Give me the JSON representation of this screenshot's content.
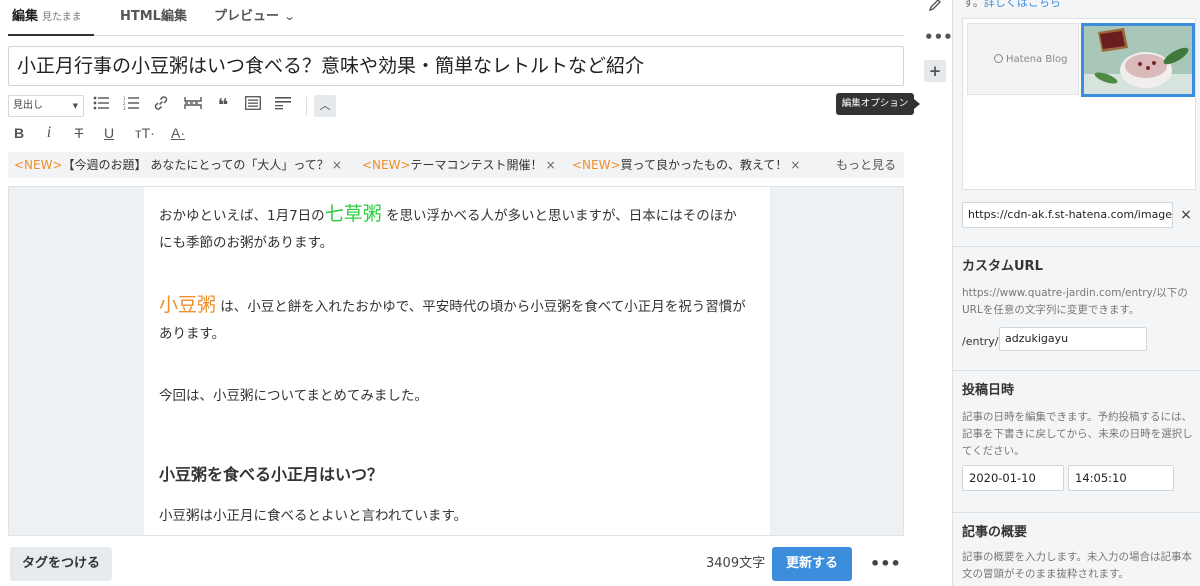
{
  "tabs": {
    "edit": "編集",
    "edit_sub": "見たまま",
    "html": "HTML編集",
    "preview": "プレビュー"
  },
  "title": "小正月行事の小豆粥はいつ食べる？意味や効果・簡単なレトルトなど紹介",
  "toolbar": {
    "heading_select": "見出し",
    "bold": "B",
    "italic": "i",
    "strike": "T",
    "underline": "U",
    "text_size": "тT·",
    "text_color": "A·"
  },
  "notice": {
    "items": [
      {
        "badge": "<NEW>",
        "text": "【今週のお題】 あなたにとっての「大人」って？",
        "close": "×"
      },
      {
        "badge": "<NEW>",
        "text": "テーマコンテスト開催！",
        "close": "×"
      },
      {
        "badge": "<NEW>",
        "text": "買って良かったもの、教えて！",
        "close": "×"
      }
    ],
    "more": "もっと見る"
  },
  "content": {
    "p1_a": "おかゆといえば、1月7日の",
    "p1_hl": "七草粥",
    "p1_b": " を思い浮かべる人が多いと思いますが、日本にはそのほかにも季節のお粥があります。",
    "p2_hl": "小豆粥",
    "p2_b": " は、小豆と餅を入れたおかゆで、平安時代の頃から小豆粥を食べて小正月を祝う習慣があります。",
    "p3": "今回は、小豆粥についてまとめてみました。",
    "h3": "小豆粥を食べる小正月はいつ？",
    "p4": "小豆粥は小正月に食べるとよいと言われています。"
  },
  "bottom": {
    "tag_button": "タグをつける",
    "char_count": "3409文字",
    "update_button": "更新する",
    "more": "•••"
  },
  "tooltip": "編集オプション",
  "sidebar": {
    "top_text_prefix": "す。",
    "top_link": "詳しくはこちら",
    "thumb1_label": "Hatena Blog",
    "image_url": "https://cdn-ak.f.st-hatena.com/images",
    "image_url_clear": "×",
    "custom_url": {
      "heading": "カスタムURL",
      "desc": "https://www.quatre-jardin.com/entry/以下のURLを任意の文字列に変更できます。",
      "prefix": "/entry/",
      "value": "adzukigayu"
    },
    "post_date": {
      "heading": "投稿日時",
      "desc": "記事の日時を編集できます。予約投稿するには、記事を下書きに戻してから、未来の日時を選択してください。",
      "date": "2020-01-10",
      "time": "14:05:10"
    },
    "summary": {
      "heading": "記事の概要",
      "desc": "記事の概要を入力します。未入力の場合は記事本文の冒頭がそのまま抜粋されます。"
    }
  },
  "colors": {
    "accent": "#3b8edb",
    "new_badge": "#f08f29",
    "highlight_green": "#2ecc40",
    "highlight_orange": "#f08f29"
  }
}
